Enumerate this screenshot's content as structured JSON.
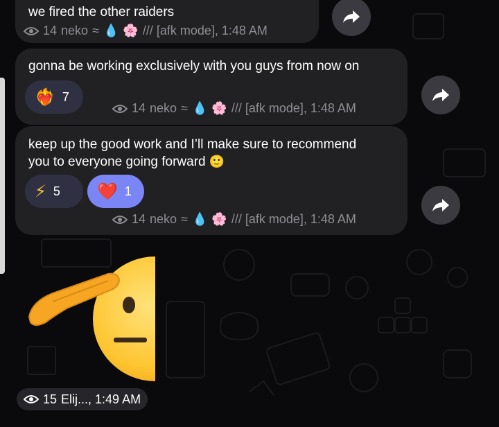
{
  "messages": [
    {
      "text_lines": [
        "we fired the other raiders"
      ],
      "views": "14",
      "sender": "neko",
      "sender_suffix": "/// [afk mode], 1:48 AM",
      "reactions": []
    },
    {
      "text_lines": [
        "gonna be working exclusively with you guys from now on"
      ],
      "views": "14",
      "sender": "neko",
      "sender_suffix": "/// [afk mode], 1:48 AM",
      "reactions": [
        {
          "emoji": "heart-on-fire",
          "count": "7"
        }
      ]
    },
    {
      "text_lines": [
        "keep up the good work and I’ll make sure to recommend",
        "you to everyone going forward"
      ],
      "views": "14",
      "sender": "neko",
      "sender_suffix": "/// [afk mode], 1:48 AM",
      "reactions": [
        {
          "emoji": "high-voltage",
          "count": "5"
        },
        {
          "emoji": "red-heart",
          "count": "1"
        }
      ]
    }
  ],
  "sticker": {
    "emoji": "saluting-face",
    "views": "15",
    "sender_time": "Elij..., 1:49 AM"
  },
  "colors": {
    "bubble": "#212124",
    "reaction_bg": "#2f3142",
    "reaction_active": "#7b86f6",
    "meta_text": "#8e8e93"
  }
}
